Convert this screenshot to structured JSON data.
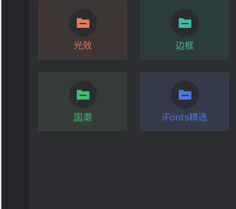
{
  "cards": [
    {
      "label": "光效",
      "icon": "folder-icon",
      "color": "#e5795b",
      "bg": "#3e3634"
    },
    {
      "label": "边框",
      "icon": "folder-icon",
      "color": "#45b8a1",
      "bg": "#2b3c3b"
    },
    {
      "label": "国潮",
      "icon": "folder-icon",
      "color": "#3fbf6f",
      "bg": "#353c37"
    },
    {
      "label": "iFonts精选",
      "icon": "folder-icon",
      "color": "#4b78dd",
      "bg": "#353a4b"
    }
  ]
}
